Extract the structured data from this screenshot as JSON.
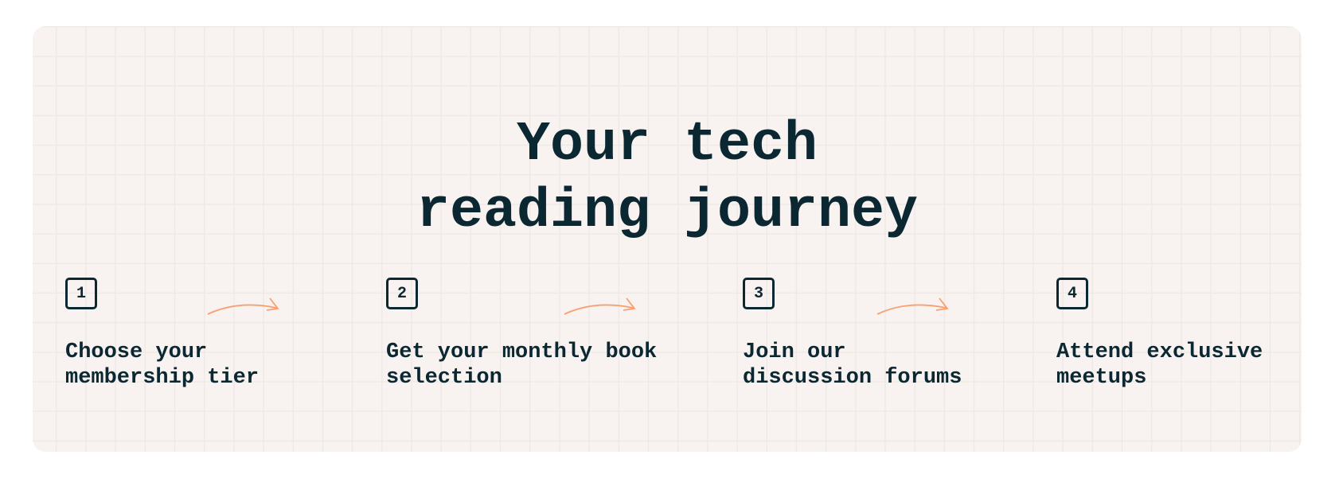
{
  "title": {
    "line1": "Your tech",
    "line2": "reading journey"
  },
  "steps": [
    {
      "number": "1",
      "line1": "Choose your",
      "line2": "membership tier"
    },
    {
      "number": "2",
      "line1": "Get your monthly book",
      "line2": "selection"
    },
    {
      "number": "3",
      "line1": "Join our",
      "line2": "discussion forums"
    },
    {
      "number": "4",
      "line1": "Attend exclusive",
      "line2": "meetups"
    }
  ],
  "colors": {
    "text": "#0b2832",
    "arrow": "#f9a070",
    "card": "#f8f3f1"
  }
}
